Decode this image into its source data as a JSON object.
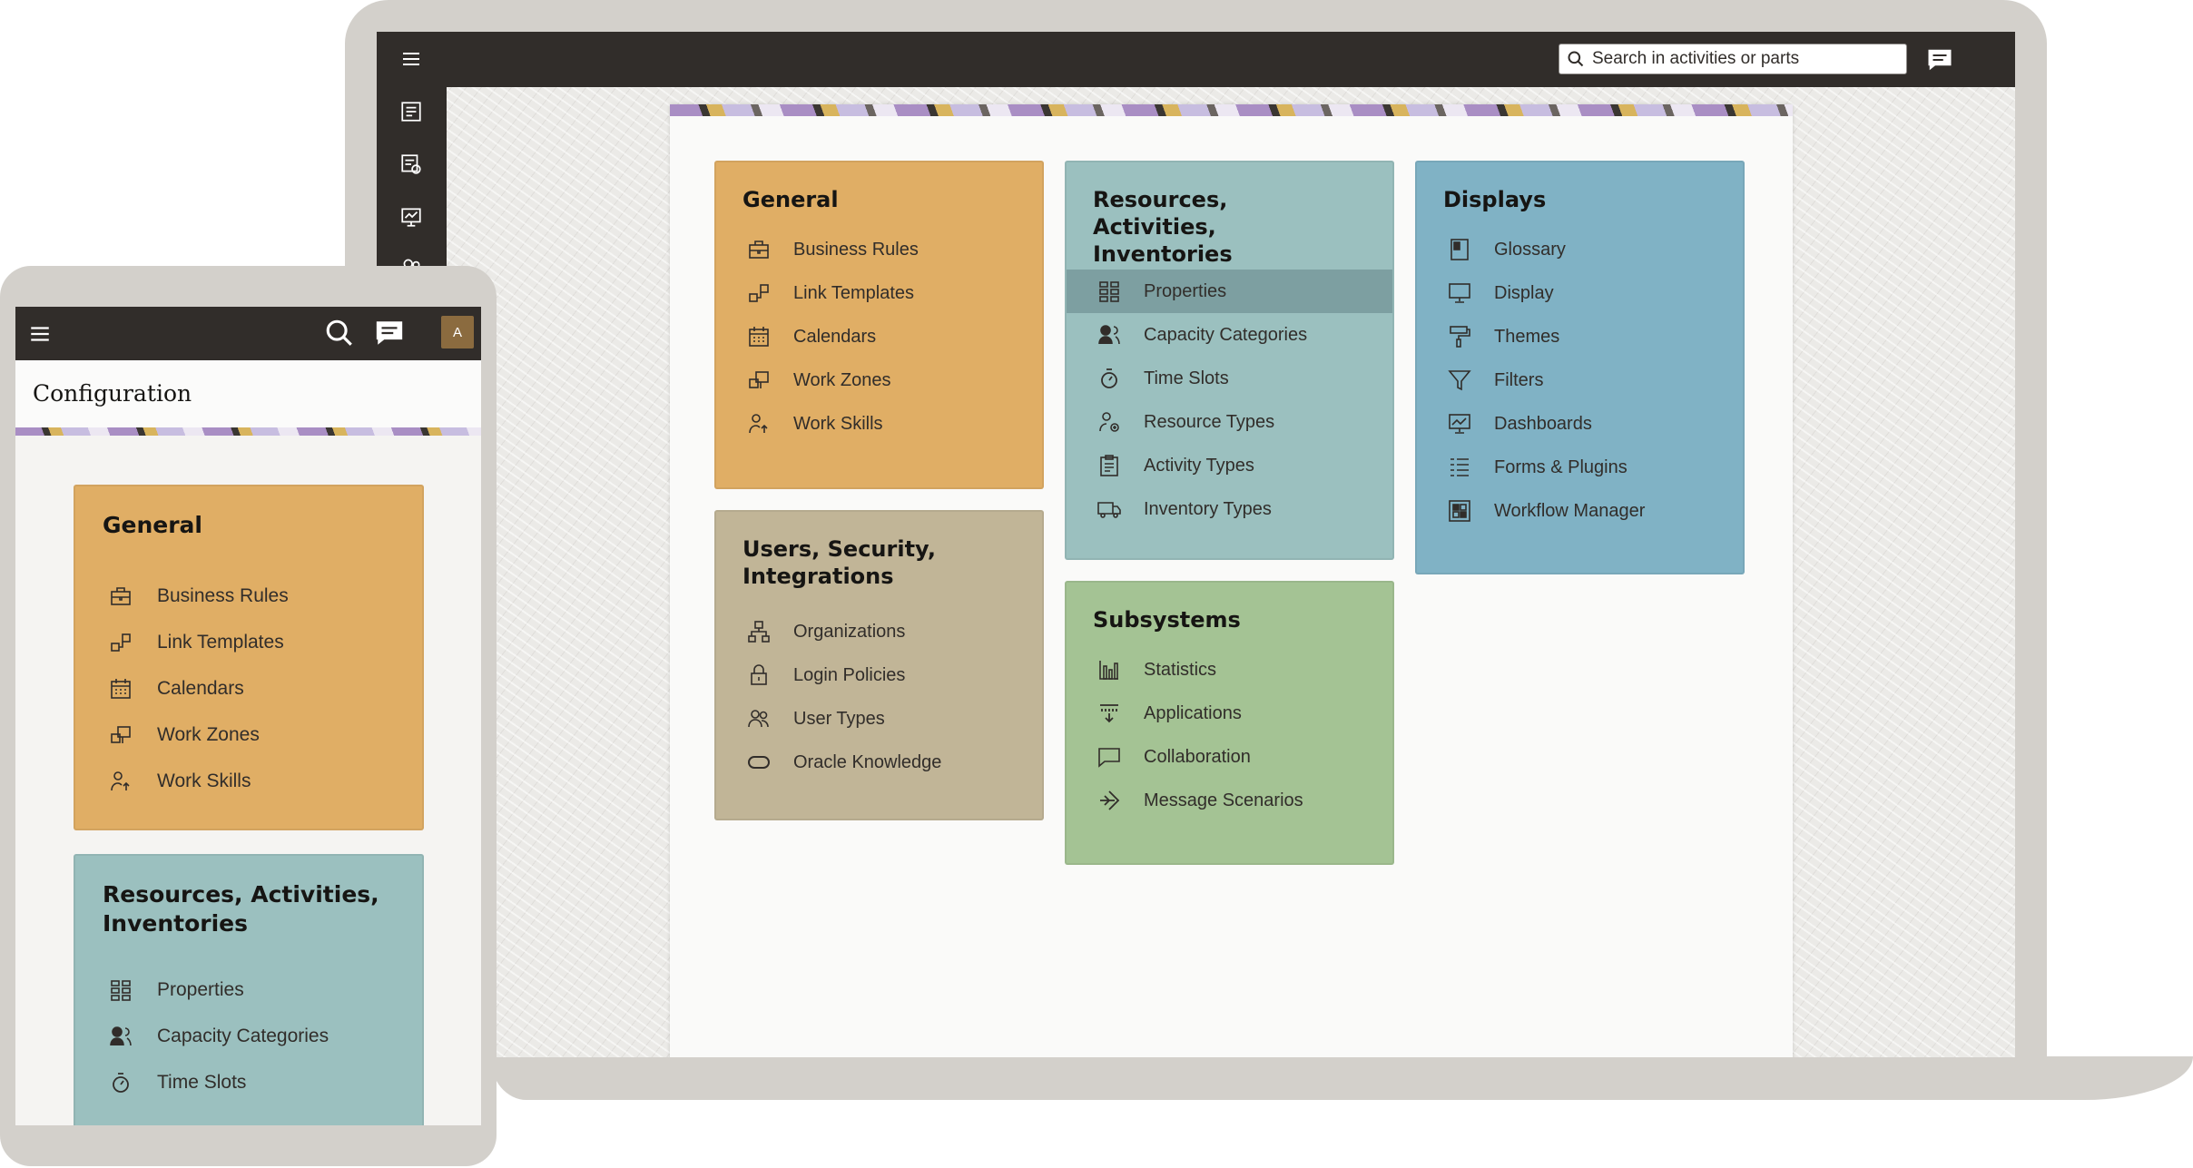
{
  "laptop": {
    "search": {
      "placeholder": "Search in activities or parts",
      "icon": "search-icon"
    },
    "rail_icons": [
      "menu-icon",
      "activity-list-icon",
      "dispatch-console-icon",
      "dashboard-icon",
      "resources-icon"
    ],
    "chat_icon": "chat-icon",
    "cards": {
      "general": {
        "title": "General",
        "items": [
          {
            "label": "Business Rules",
            "icon": "briefcase-icon"
          },
          {
            "label": "Link Templates",
            "icon": "link-templates-icon"
          },
          {
            "label": "Calendars",
            "icon": "calendar-icon"
          },
          {
            "label": "Work Zones",
            "icon": "work-zones-icon"
          },
          {
            "label": "Work Skills",
            "icon": "work-skills-icon"
          }
        ]
      },
      "resources": {
        "title": "Resources, Activities, Inventories",
        "items": [
          {
            "label": "Properties",
            "icon": "grid-icon",
            "selected": true
          },
          {
            "label": "Capacity Categories",
            "icon": "capacity-icon"
          },
          {
            "label": "Time Slots",
            "icon": "timer-icon"
          },
          {
            "label": "Resource Types",
            "icon": "resource-type-icon"
          },
          {
            "label": "Activity Types",
            "icon": "clipboard-icon"
          },
          {
            "label": "Inventory Types",
            "icon": "truck-icon"
          }
        ]
      },
      "displays": {
        "title": "Displays",
        "items": [
          {
            "label": "Glossary",
            "icon": "glossary-icon"
          },
          {
            "label": "Display",
            "icon": "monitor-icon"
          },
          {
            "label": "Themes",
            "icon": "paint-roller-icon"
          },
          {
            "label": "Filters",
            "icon": "filter-icon"
          },
          {
            "label": "Dashboards",
            "icon": "dashboard-icon"
          },
          {
            "label": "Forms & Plugins",
            "icon": "forms-icon"
          },
          {
            "label": "Workflow Manager",
            "icon": "workflow-icon"
          }
        ]
      },
      "users": {
        "title": "Users, Security, Integrations",
        "items": [
          {
            "label": "Organizations",
            "icon": "org-chart-icon"
          },
          {
            "label": "Login Policies",
            "icon": "lock-icon"
          },
          {
            "label": "User Types",
            "icon": "users-icon"
          },
          {
            "label": "Oracle Knowledge",
            "icon": "oracle-icon"
          }
        ]
      },
      "subsystems": {
        "title": "Subsystems",
        "items": [
          {
            "label": "Statistics",
            "icon": "bar-chart-icon"
          },
          {
            "label": "Applications",
            "icon": "applications-icon"
          },
          {
            "label": "Collaboration",
            "icon": "speech-bubble-icon"
          },
          {
            "label": "Message Scenarios",
            "icon": "message-scenario-icon"
          }
        ]
      }
    }
  },
  "phone": {
    "page_title": "Configuration",
    "avatar_initial": "A",
    "header_icons": [
      "menu-icon",
      "search-icon",
      "chat-icon"
    ],
    "cards": {
      "general": {
        "title": "General",
        "items": [
          {
            "label": "Business Rules",
            "icon": "briefcase-icon"
          },
          {
            "label": "Link Templates",
            "icon": "link-templates-icon"
          },
          {
            "label": "Calendars",
            "icon": "calendar-icon"
          },
          {
            "label": "Work Zones",
            "icon": "work-zones-icon"
          },
          {
            "label": "Work Skills",
            "icon": "work-skills-icon"
          }
        ]
      },
      "resources": {
        "title": "Resources, Activities, Inventories",
        "items": [
          {
            "label": "Properties",
            "icon": "grid-icon"
          },
          {
            "label": "Capacity Categories",
            "icon": "capacity-icon"
          },
          {
            "label": "Time Slots",
            "icon": "timer-icon"
          }
        ]
      }
    }
  },
  "colors": {
    "header": "#312d2a",
    "general": "#e0ae65",
    "resources": "#9bc0bf",
    "displays": "#80b2c5",
    "users": "#c1b597",
    "subsystems": "#a4c394",
    "selected_row": "#7d9fa1"
  }
}
